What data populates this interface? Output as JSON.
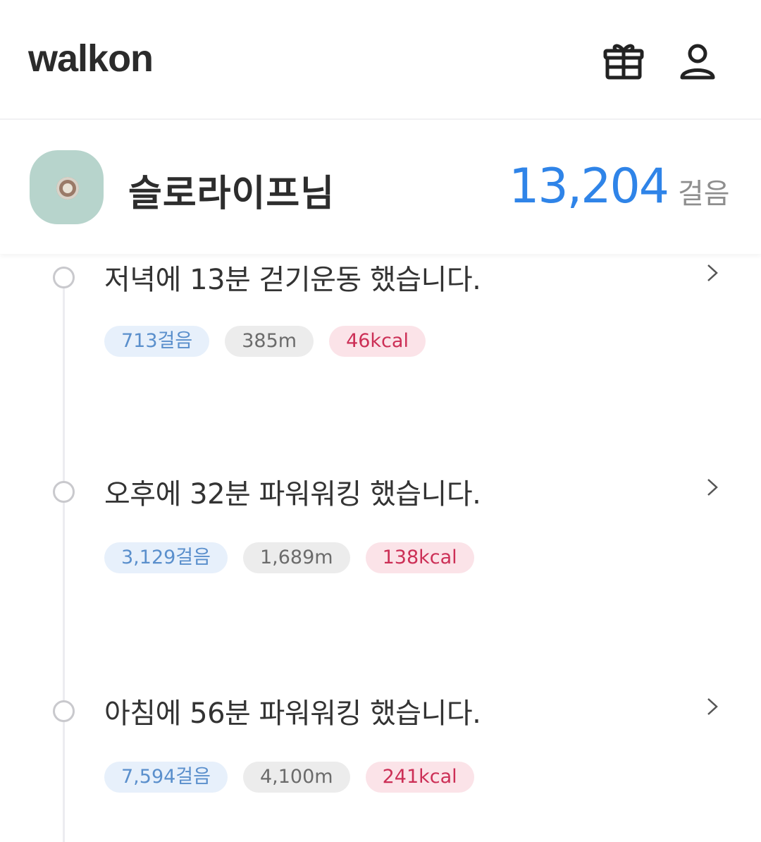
{
  "header": {
    "logo": "walkon",
    "icons": [
      "gift-icon",
      "user-icon"
    ]
  },
  "profile": {
    "name": "슬로라이프님",
    "steps": "13,204",
    "steps_unit": "걸음"
  },
  "activities": [
    {
      "title": "저녁에 13분 걷기운동 했습니다.",
      "steps": "713걸음",
      "distance": "385m",
      "kcal": "46kcal"
    },
    {
      "title": "오후에 32분 파워워킹 했습니다.",
      "steps": "3,129걸음",
      "distance": "1,689m",
      "kcal": "138kcal"
    },
    {
      "title": "아침에 56분 파워워킹 했습니다.",
      "steps": "7,594걸음",
      "distance": "4,100m",
      "kcal": "241kcal"
    }
  ],
  "colors": {
    "accent_blue": "#2f84e8",
    "steps_chip_bg": "#e7f0fb",
    "kcal_text": "#cc2f56",
    "kcal_chip_bg": "#fbe3e8"
  }
}
